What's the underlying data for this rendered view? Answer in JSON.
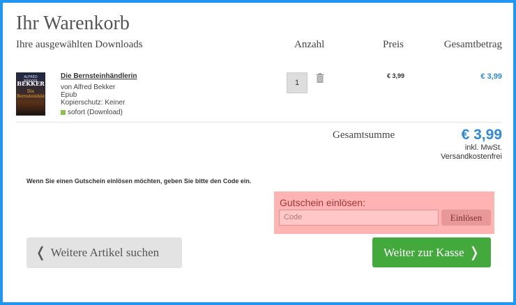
{
  "cart": {
    "title": "Ihr Warenkorb",
    "subtitle": "Ihre ausgewählten Downloads",
    "columns": {
      "quantity": "Anzahl",
      "price": "Preis",
      "total": "Gesamtbetrag"
    }
  },
  "item": {
    "cover_author": "ALFRED BEKKER",
    "cover_author_short": "BEKKER",
    "cover_title": "Die Bernsteinhändlerin",
    "name": "Die Bernsteinhändlerin",
    "author": "von Alfred Bekker",
    "format": "Epub",
    "protection": "Kopierschutz: Keiner",
    "availability": "sofort (Download)",
    "quantity": "1",
    "unit_price": "€ 3,99",
    "line_total": "€ 3,99"
  },
  "summary": {
    "label": "Gesamtsumme",
    "value": "€ 3,99",
    "tax_note": "inkl. MwSt.",
    "shipping_note": "Versandkostenfrei"
  },
  "voucher": {
    "info": "Wenn Sie einen Gutschein einlösen möchten, geben Sie bitte den Code ein.",
    "label": "Gutschein einlösen:",
    "placeholder": "Code",
    "button": "Einlösen"
  },
  "buttons": {
    "back": "Weitere Artikel suchen",
    "checkout": "Weiter zur Kasse"
  },
  "icons": {
    "trash": "trash-icon",
    "chevron_left": "chevron-left-icon",
    "chevron_right": "chevron-right-icon",
    "availability": "availability-indicator-icon"
  },
  "colors": {
    "frame": "#2196f3",
    "price_accent": "#2e8ad8",
    "checkout": "#43a93d",
    "voucher_bg": "#ffb3b3"
  }
}
